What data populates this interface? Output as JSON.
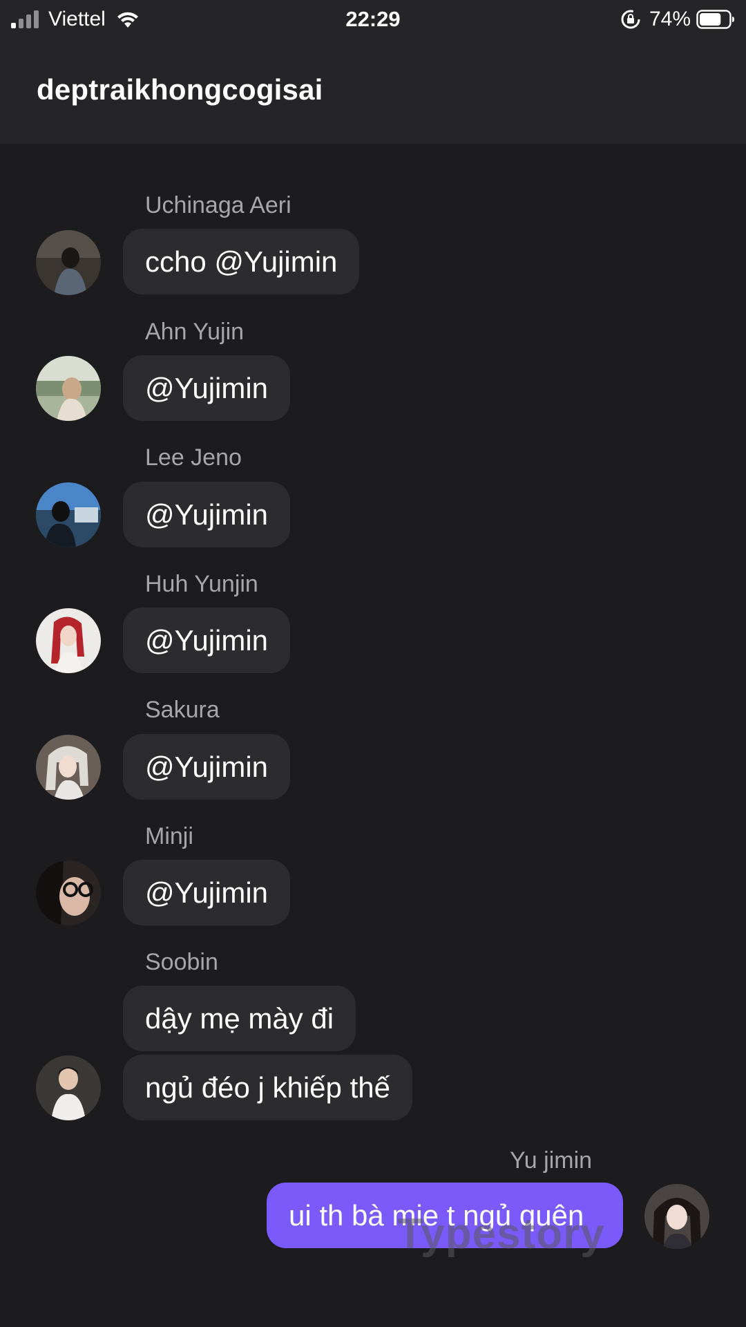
{
  "status_bar": {
    "carrier": "Viettel",
    "time": "22:29",
    "battery": "74%",
    "battery_level": 0.74
  },
  "header": {
    "title": "deptraikhongcogisai"
  },
  "messages": [
    {
      "sender": "Uchinaga Aeri",
      "text": "ccho @Yujimin"
    },
    {
      "sender": "Ahn Yujin",
      "text": "@Yujimin"
    },
    {
      "sender": "Lee Jeno",
      "text": "@Yujimin"
    },
    {
      "sender": "Huh Yunjin",
      "text": "@Yujimin"
    },
    {
      "sender": "Sakura",
      "text": "@Yujimin"
    },
    {
      "sender": "Minji",
      "text": "@Yujimin"
    },
    {
      "sender": "Soobin",
      "text": "dậy mẹ mày đi",
      "text2": "ngủ đéo j khiếp thế"
    },
    {
      "sender": "Yu jimin",
      "text": "ui th bà mie t ngủ quên"
    }
  ],
  "watermark": "Typestory",
  "colors": {
    "background": "#1c1c1e",
    "header": "#252527",
    "bubble": "#2c2c2e",
    "bubble_mine": "#7a5af8",
    "sender": "#a7a7ab"
  }
}
